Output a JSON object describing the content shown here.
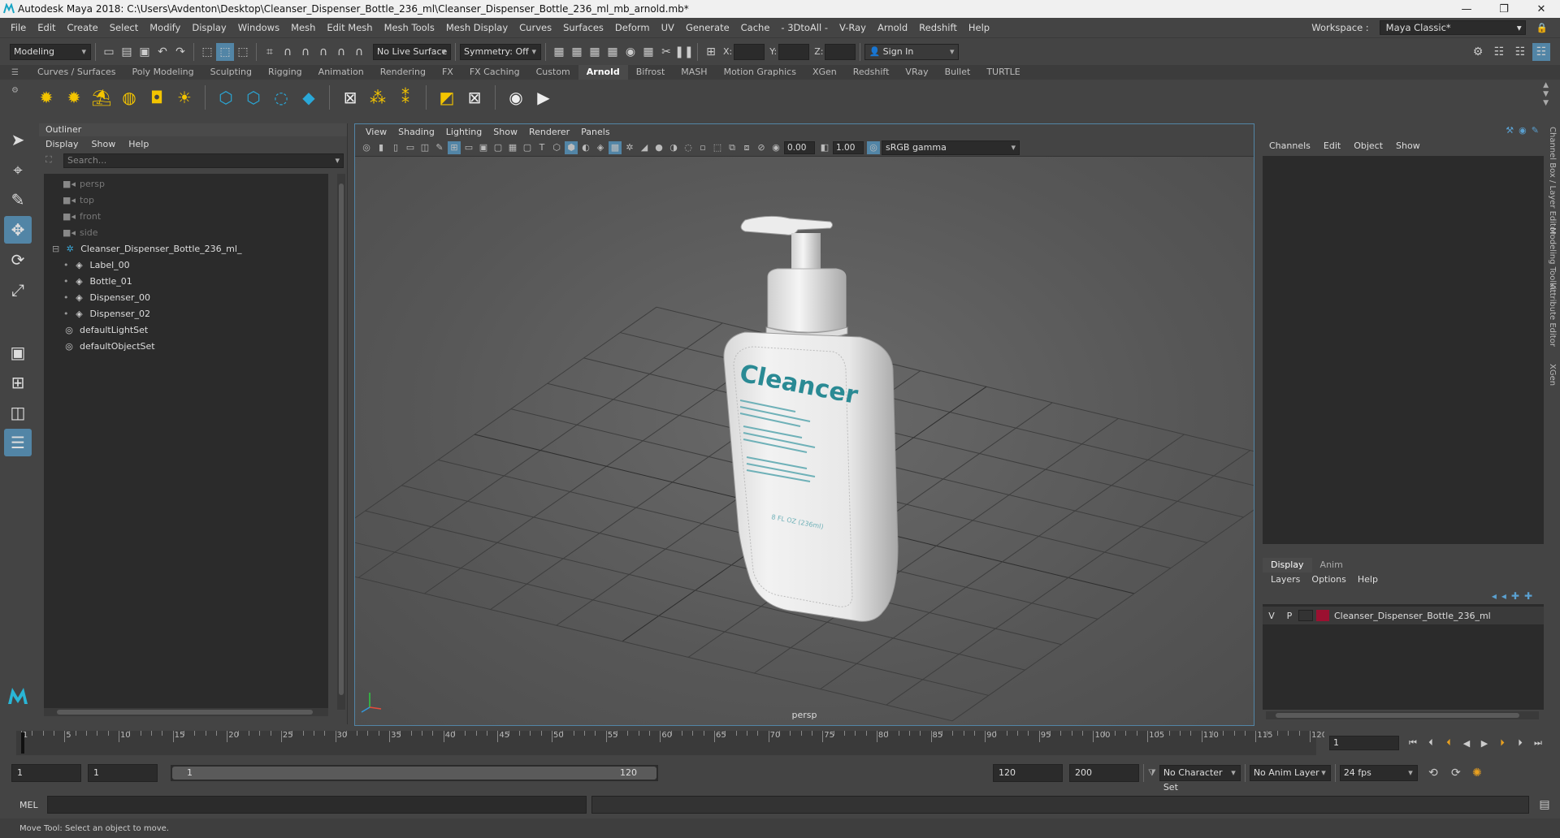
{
  "title_bar": {
    "title": "Autodesk Maya 2018: C:\\Users\\Avdenton\\Desktop\\Cleanser_Dispenser_Bottle_236_ml\\Cleanser_Dispenser_Bottle_236_ml_mb_arnold.mb*",
    "app_icon": "maya-icon"
  },
  "menu": [
    "File",
    "Edit",
    "Create",
    "Select",
    "Modify",
    "Display",
    "Windows",
    "Mesh",
    "Edit Mesh",
    "Mesh Tools",
    "Mesh Display",
    "Curves",
    "Surfaces",
    "Deform",
    "UV",
    "Generate",
    "Cache",
    "- 3DtoAll -",
    "V-Ray",
    "Arnold",
    "Redshift",
    "Help"
  ],
  "workspace": {
    "label": "Workspace :",
    "value": "Maya Classic*"
  },
  "status_line": {
    "mode": "Modeling",
    "live_surface": "No Live Surface",
    "symmetry": "Symmetry: Off",
    "x_label": "X:",
    "y_label": "Y:",
    "z_label": "Z:",
    "sign_in": "Sign In"
  },
  "shelf_tabs": [
    "Curves / Surfaces",
    "Poly Modeling",
    "Sculpting",
    "Rigging",
    "Animation",
    "Rendering",
    "FX",
    "FX Caching",
    "Custom",
    "Arnold",
    "Bifrost",
    "MASH",
    "Motion Graphics",
    "XGen",
    "Redshift",
    "VRay",
    "Bullet",
    "TURTLE"
  ],
  "shelf_active": "Arnold",
  "outliner": {
    "title": "Outliner",
    "menu": [
      "Display",
      "Show",
      "Help"
    ],
    "search_placeholder": "Search...",
    "items": [
      {
        "label": "persp",
        "icon": "camera-icon",
        "dim": true,
        "indent": 1
      },
      {
        "label": "top",
        "icon": "camera-icon",
        "dim": true,
        "indent": 1
      },
      {
        "label": "front",
        "icon": "camera-icon",
        "dim": true,
        "indent": 1
      },
      {
        "label": "side",
        "icon": "camera-icon",
        "dim": true,
        "indent": 1
      },
      {
        "label": "Cleanser_Dispenser_Bottle_236_ml_",
        "icon": "group-icon",
        "dim": false,
        "indent": 0,
        "expand": "⊟"
      },
      {
        "label": "Label_00",
        "icon": "mesh-icon",
        "dim": false,
        "indent": 2
      },
      {
        "label": "Bottle_01",
        "icon": "mesh-icon",
        "dim": false,
        "indent": 2
      },
      {
        "label": "Dispenser_00",
        "icon": "mesh-icon",
        "dim": false,
        "indent": 2
      },
      {
        "label": "Dispenser_02",
        "icon": "mesh-icon",
        "dim": false,
        "indent": 2
      },
      {
        "label": "defaultLightSet",
        "icon": "set-icon",
        "dim": false,
        "indent": 1
      },
      {
        "label": "defaultObjectSet",
        "icon": "set-icon",
        "dim": false,
        "indent": 1
      }
    ]
  },
  "viewport": {
    "menu": [
      "View",
      "Shading",
      "Lighting",
      "Show",
      "Renderer",
      "Panels"
    ],
    "exposure": "0.00",
    "gamma": "1.00",
    "color_space": "sRGB gamma",
    "camera": "persp",
    "label_text": "Cleancer",
    "capacity_text": "8 FL OZ (236ml)"
  },
  "channel_box": {
    "menu": [
      "Channels",
      "Edit",
      "Object",
      "Show"
    ],
    "display_tabs": [
      "Display",
      "Anim"
    ],
    "layer_menu": [
      "Layers",
      "Options",
      "Help"
    ],
    "layer": {
      "v": "V",
      "p": "P",
      "name": "Cleanser_Dispenser_Bottle_236_ml",
      "color": "#9b1030"
    }
  },
  "side_tabs": [
    "Channel Box / Layer Editor",
    "Modeling Toolkit",
    "Attribute Editor",
    "XGen"
  ],
  "timeline": {
    "ticks": [
      "1",
      "5",
      "10",
      "15",
      "20",
      "25",
      "30",
      "35",
      "40",
      "45",
      "50",
      "55",
      "60",
      "65",
      "70",
      "75",
      "80",
      "85",
      "90",
      "95",
      "100",
      "105",
      "110",
      "115",
      "120"
    ],
    "current_frame": "1"
  },
  "range": {
    "start": "1",
    "playback_start": "1",
    "slider_start": "1",
    "slider_end": "120",
    "playback_end": "120",
    "end": "200",
    "character_set": "No Character Set",
    "anim_layer": "No Anim Layer",
    "fps": "24 fps"
  },
  "command": {
    "label": "MEL"
  },
  "help_line": "Move Tool: Select an object to move."
}
